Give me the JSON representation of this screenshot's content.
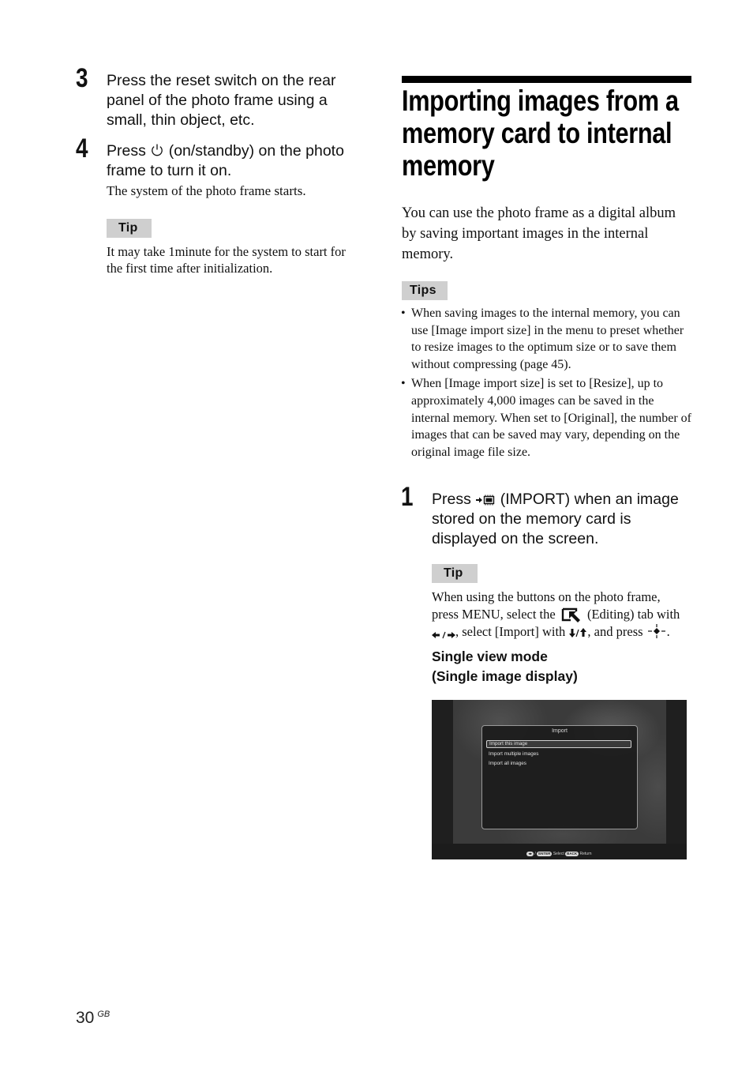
{
  "left_column": {
    "steps": [
      {
        "number": "3",
        "text": "Press the reset switch on the rear panel of the photo frame using a small, thin object, etc."
      },
      {
        "number": "4",
        "text_before_icon": "Press",
        "icon": "power-standby-icon",
        "text_after_icon": "(on/standby) on the photo frame to turn it on.",
        "note": "The system of the photo frame starts."
      }
    ],
    "tip": {
      "label": "Tip",
      "text": "It may take 1minute for the system to start for the first time after initialization."
    }
  },
  "right_column": {
    "title": "Importing images from a memory card to internal memory",
    "intro": "You can use the photo frame as a digital album by saving important images in the internal memory.",
    "tips": {
      "label": "Tips",
      "items": [
        "When saving images to the internal memory, you can use [Image import size] in the menu to preset whether to resize images to the optimum size or to save them without compressing (page 45).",
        "When [Image import size] is set to [Resize], up to approximately 4,000 images can be saved in the internal memory. When set to [Original], the number of images that can be saved may vary, depending on the original image file size."
      ]
    },
    "step1": {
      "number": "1",
      "text_before_icon": "Press",
      "icon": "import-icon",
      "text_after_icon": "(IMPORT) when an image stored on the memory card is displayed on the screen."
    },
    "tip": {
      "label": "Tip",
      "line1": "When using the buttons on the photo frame,",
      "line2_a": "press MENU, select the",
      "line2_icon": "editing-tab-icon",
      "line2_b": "(Editing) tab with",
      "line3_a": ", select [Import] with",
      "line3_b": ", and press",
      "line3_c": ".",
      "lr_arrows": "←/→",
      "ud_arrows": "↓/↑"
    },
    "subhead": {
      "line1": "Single view mode",
      "line2": "(Single image display)"
    },
    "screen": {
      "dialog_title": "Import",
      "menu_items": [
        {
          "label": "Import this image",
          "selected": true
        },
        {
          "label": "Import multiple images",
          "selected": false
        },
        {
          "label": "Import all images",
          "selected": false
        }
      ],
      "hint": {
        "nav_sep": "/",
        "enter_key": "ENTER",
        "select_label": "Select",
        "back_key": "BACK",
        "return_label": "Return"
      }
    }
  },
  "footer": {
    "page_number": "30",
    "region": "GB"
  }
}
